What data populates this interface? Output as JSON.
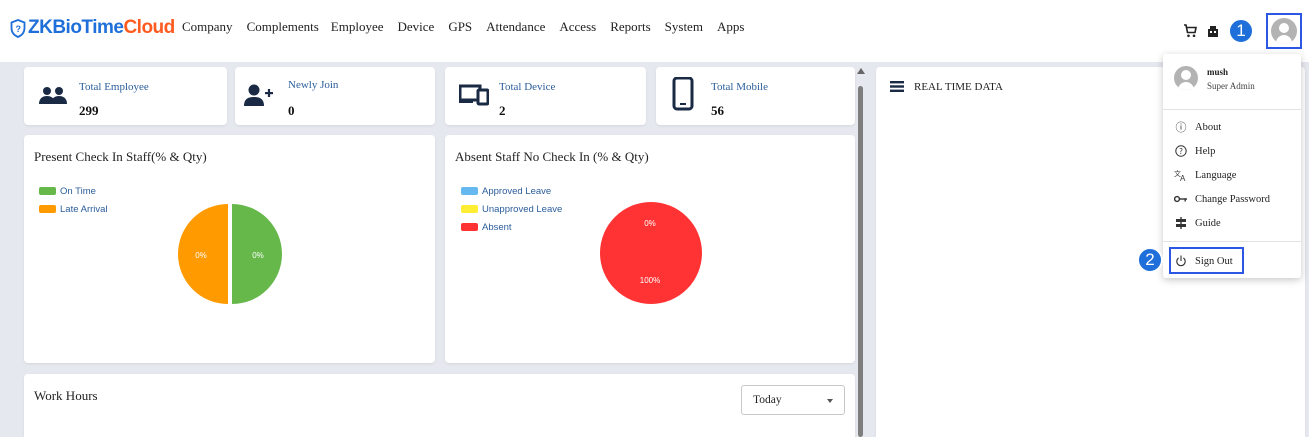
{
  "app": {
    "logo_prefix": "ZKBioTime",
    "logo_suffix": "Cloud",
    "brand_blue": "#1e6fd9",
    "brand_orange": "#ff5a1f"
  },
  "nav": [
    "Company",
    "Complements",
    "Employee",
    "Device",
    "GPS",
    "Attendance",
    "Access",
    "Reports",
    "System",
    "Apps"
  ],
  "header_icons": [
    "cart-icon",
    "building-icon",
    "user-avatar-icon"
  ],
  "annotations": {
    "step1": "1",
    "step2": "2",
    "highlight_color": "#2b57e3"
  },
  "stats": [
    {
      "label": "Total Employee",
      "value": "299",
      "icon": "group-icon"
    },
    {
      "label": "Newly Join",
      "value": "0",
      "icon": "person-add-icon"
    },
    {
      "label": "Total Device",
      "value": "2",
      "icon": "devices-icon"
    },
    {
      "label": "Total Mobile",
      "value": "56",
      "icon": "mobile-icon"
    }
  ],
  "present_panel": {
    "title": "Present Check In Staff(% & Qty)",
    "legend": [
      {
        "label": "On Time",
        "color": "#66b84a"
      },
      {
        "label": "Late Arrival",
        "color": "#ff9a00"
      }
    ],
    "pie_labels": [
      "0%",
      "0%"
    ],
    "pie_shares": [
      50,
      50
    ]
  },
  "absent_panel": {
    "title": "Absent Staff No Check In (% & Qty)",
    "legend": [
      {
        "label": "Approved Leave",
        "color": "#66b9f0"
      },
      {
        "label": "Unapproved Leave",
        "color": "#ffee33"
      },
      {
        "label": "Absent",
        "color": "#ff3333"
      }
    ],
    "pie_labels": [
      "0%",
      "100%"
    ],
    "pie_shares": [
      0,
      100
    ]
  },
  "realtime": {
    "title": "REAL TIME DATA"
  },
  "work_hours": {
    "title": "Work Hours",
    "period": "Today"
  },
  "user_menu": {
    "name": "mush",
    "role": "Super Admin",
    "items": [
      {
        "label": "About",
        "icon": "info-icon"
      },
      {
        "label": "Help",
        "icon": "help-icon"
      },
      {
        "label": "Language",
        "icon": "translate-icon"
      },
      {
        "label": "Change Password",
        "icon": "key-icon"
      },
      {
        "label": "Guide",
        "icon": "guide-icon"
      }
    ],
    "sign_out": {
      "label": "Sign Out",
      "icon": "power-icon"
    }
  }
}
